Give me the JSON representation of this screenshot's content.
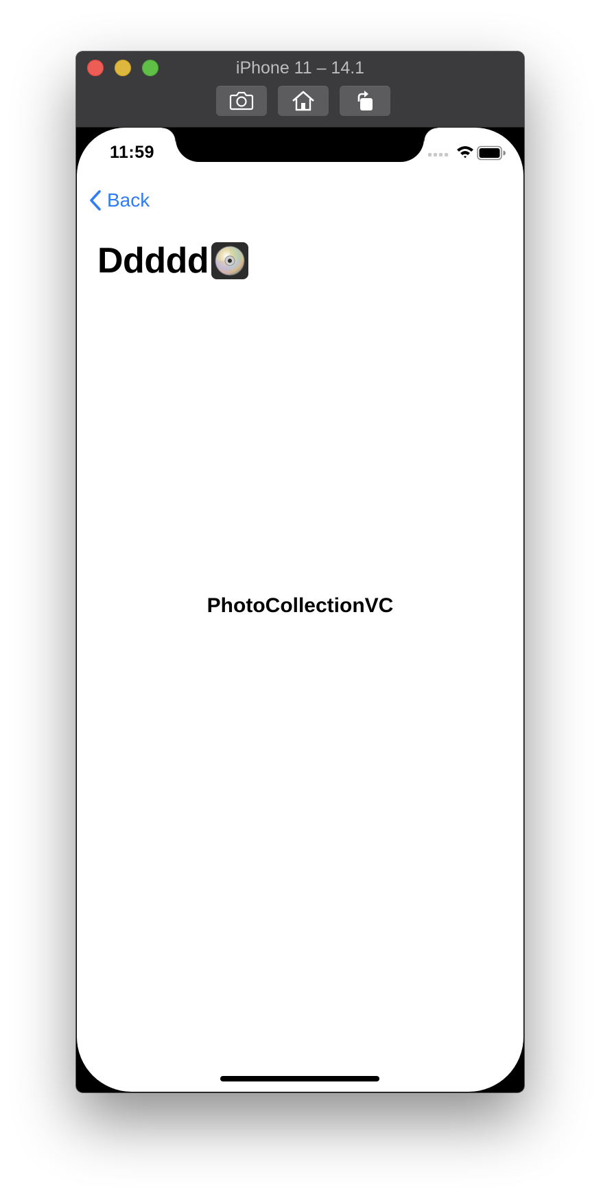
{
  "window": {
    "title": "iPhone 11 – 14.1",
    "toolbar_icons": [
      "screenshot-icon",
      "home-icon",
      "rotate-icon"
    ]
  },
  "status_bar": {
    "time": "11:59",
    "icons": [
      "cellular-signal-icon",
      "wifi-icon",
      "battery-icon"
    ]
  },
  "nav_bar": {
    "back_label": "Back",
    "large_title": "Ddddd",
    "title_icon": "optical-disc-icon"
  },
  "content": {
    "center_label": "PhotoCollectionVC"
  },
  "colors": {
    "accent": "#2f7cf6",
    "titlebar": "#3b3b3d",
    "close": "#ee5d55",
    "minimize": "#ddb73e",
    "zoom": "#60bf47"
  }
}
